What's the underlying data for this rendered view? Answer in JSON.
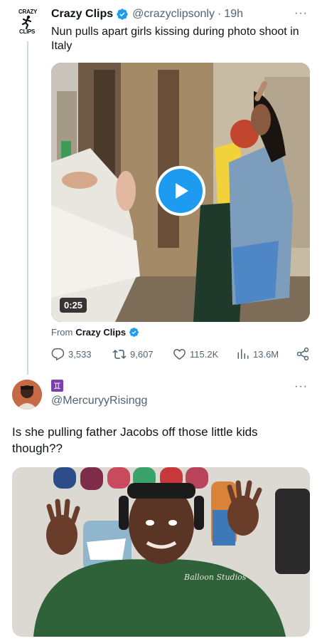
{
  "tweet": {
    "avatar_text_top": "CRAZY",
    "avatar_text_bottom": "CLIPS",
    "author_name": "Crazy Clips",
    "handle": "@crazyclipsonly",
    "separator": "·",
    "time": "19h",
    "more": "···",
    "text": "Nun pulls apart girls kissing during photo shoot in Italy",
    "video_duration": "0:25",
    "from_prefix": "From",
    "from_source": "Crazy Clips",
    "stats": {
      "replies": "3,533",
      "retweets": "9,607",
      "likes": "115.2K",
      "views": "13.6M"
    }
  },
  "reply": {
    "badge": "♊",
    "handle": "@MercuryyRisingg",
    "more": "···",
    "text": "Is she pulling father Jacobs off those little kids though??",
    "hoodie_text": "Balloon Studios"
  },
  "colors": {
    "accent": "#1d9bf0",
    "muted": "#536471",
    "text": "#0f1419",
    "divider": "#cfd9de"
  },
  "icons": [
    "verified-badge-icon",
    "play-icon",
    "reply-icon",
    "retweet-icon",
    "like-icon",
    "views-icon",
    "share-icon",
    "more-icon"
  ]
}
